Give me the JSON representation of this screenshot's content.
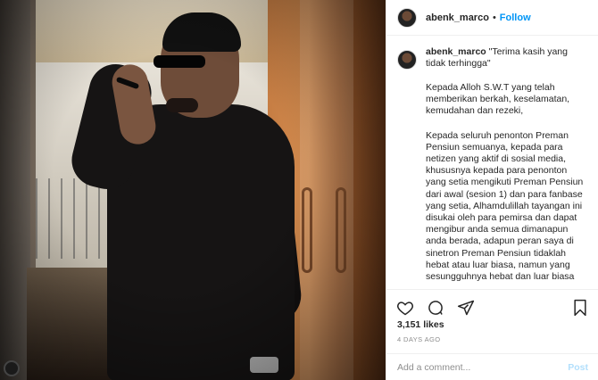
{
  "post": {
    "username": "abenk_marco",
    "separator": "•",
    "follow_label": "Follow",
    "caption_first_line": "\"Terima kasih yang tidak terhingga\"",
    "paragraph_1": "Kepada Alloh S.W.T yang telah memberikan berkah, keselamatan, kemudahan dan rezeki,",
    "paragraph_2": "Kepada seluruh penonton Preman Pensiun semuanya, kepada para netizen yang aktif di sosial media, khususnya kepada para penonton yang setia mengikuti Preman Pensiun dari awal (sesion 1) dan para fanbase yang setia, Alhamdulillah tayangan ini disukai oleh para pemirsa dan dapat mengibur anda semua dimanapun anda berada, adapun peran saya di sinetron Preman Pensiun tidaklah hebat atau luar biasa, namun yang sesungguhnya hebat dan luar biasa",
    "likes": "3,151 likes",
    "timestamp": "4 DAYS AGO",
    "comment_placeholder": "Add a comment...",
    "post_button": "Post"
  },
  "icons": {
    "like": "heart-icon",
    "comment": "comment-icon",
    "share": "share-icon",
    "save": "bookmark-icon"
  },
  "colors": {
    "follow": "#0095f6",
    "post_disabled": "#b2dffc",
    "muted": "#8e8e8e",
    "text": "#262626"
  }
}
